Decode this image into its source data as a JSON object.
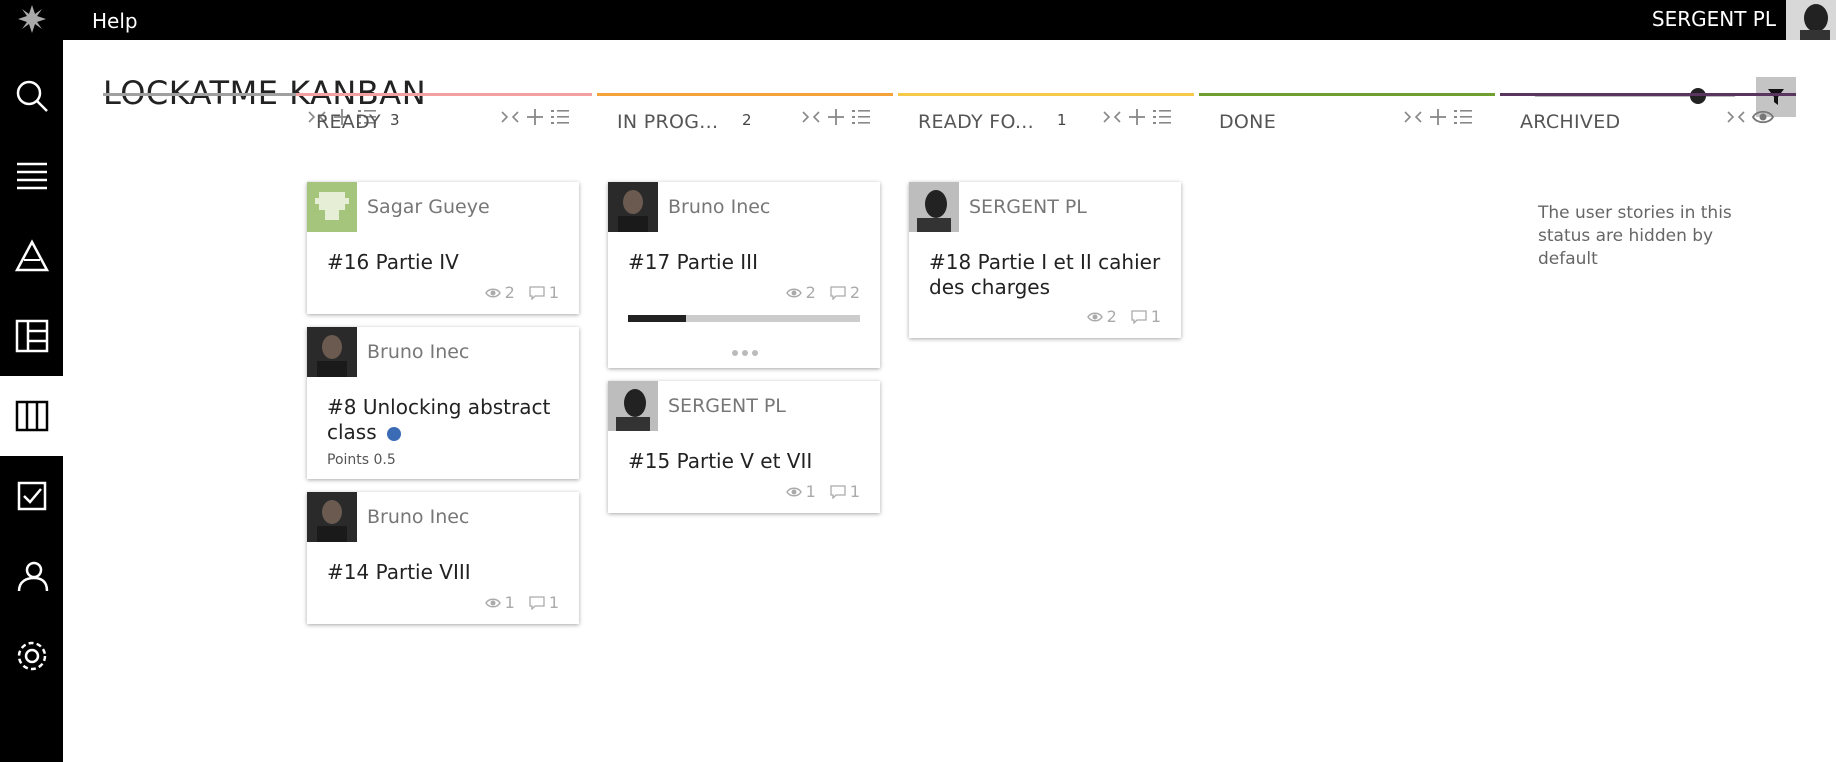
{
  "topbar": {
    "help": "Help",
    "user": "SERGENT PL"
  },
  "page": {
    "title": "LOCKATME KANBAN"
  },
  "zoom": {
    "level": 0.5
  },
  "columns": [
    {
      "name": "",
      "count": "",
      "color": "#a0a0a0"
    },
    {
      "name": "READY",
      "count": "3",
      "color": "#f4a0a0"
    },
    {
      "name": "IN PROG...",
      "count": "2",
      "color": "#f6a23a"
    },
    {
      "name": "READY FO...",
      "count": "1",
      "color": "#f6c94b"
    },
    {
      "name": "DONE",
      "count": "",
      "color": "#6f9f2e"
    },
    {
      "name": "ARCHIVED",
      "count": "",
      "color": "#5a3560"
    }
  ],
  "archived_note": "The user stories in this status are hidden by default",
  "cards": {
    "c16": {
      "assignee": "Sagar Gueye",
      "title": "#16 Partie IV",
      "views": "2",
      "comments": "1"
    },
    "c8": {
      "assignee": "Bruno Inec",
      "title": "#8 Unlocking abstract class",
      "points": "Points 0.5"
    },
    "c14": {
      "assignee": "Bruno Inec",
      "title": "#14 Partie VIII",
      "views": "1",
      "comments": "1"
    },
    "c17": {
      "assignee": "Bruno Inec",
      "title": "#17 Partie III",
      "views": "2",
      "comments": "2",
      "progress": 0.25
    },
    "c15": {
      "assignee": "SERGENT PL",
      "title": "#15 Partie V et VII",
      "views": "1",
      "comments": "1"
    },
    "c18": {
      "assignee": "SERGENT PL",
      "title": "#18 Partie I et II cahier des charges",
      "views": "2",
      "comments": "1"
    }
  },
  "colors": {
    "topbar": "#000000",
    "sidebar": "#000000",
    "accent_dot": "#3b6bb5"
  }
}
